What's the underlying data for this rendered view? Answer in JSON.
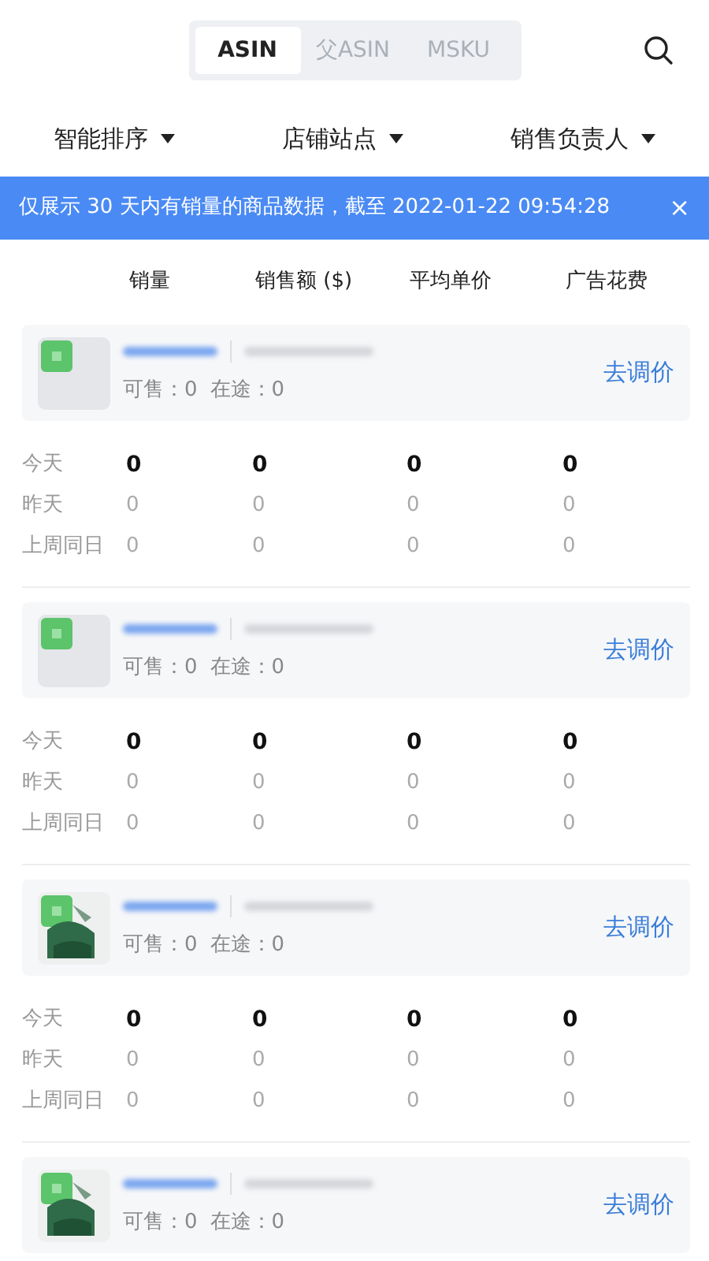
{
  "tabs": [
    {
      "label": "ASIN",
      "selected": true
    },
    {
      "label": "父ASIN",
      "selected": false
    },
    {
      "label": "MSKU",
      "selected": false
    }
  ],
  "filters": [
    "智能排序",
    "店铺站点",
    "销售负责人"
  ],
  "notice": {
    "text": "仅展示 30 天内有销量的商品数据，截至 2022-01-22 09:54:28",
    "close": "×"
  },
  "columns": [
    "销量",
    "销售额 ($)",
    "平均单价",
    "广告花费"
  ],
  "products": [
    {
      "available": "可售：0",
      "in_transit": "在途：0",
      "action": "去调价",
      "rows": [
        {
          "kind": "today",
          "label": "今天",
          "values": [
            "0",
            "0",
            "0",
            "0"
          ]
        },
        {
          "kind": "past",
          "label": "昨天",
          "values": [
            "0",
            "0",
            "0",
            "0"
          ]
        },
        {
          "kind": "past",
          "label": "上周同日",
          "values": [
            "0",
            "0",
            "0",
            "0"
          ]
        }
      ]
    },
    {
      "available": "可售：0",
      "in_transit": "在途：0",
      "action": "去调价",
      "rows": [
        {
          "kind": "today",
          "label": "今天",
          "values": [
            "0",
            "0",
            "0",
            "0"
          ]
        },
        {
          "kind": "past",
          "label": "昨天",
          "values": [
            "0",
            "0",
            "0",
            "0"
          ]
        },
        {
          "kind": "past",
          "label": "上周同日",
          "values": [
            "0",
            "0",
            "0",
            "0"
          ]
        }
      ]
    },
    {
      "available": "可售：0",
      "in_transit": "在途：0",
      "action": "去调价",
      "rows": [
        {
          "kind": "today",
          "label": "今天",
          "values": [
            "0",
            "0",
            "0",
            "0"
          ]
        },
        {
          "kind": "past",
          "label": "昨天",
          "values": [
            "0",
            "0",
            "0",
            "0"
          ]
        },
        {
          "kind": "past",
          "label": "上周同日",
          "values": [
            "0",
            "0",
            "0",
            "0"
          ]
        }
      ]
    },
    {
      "available": "可售：0",
      "in_transit": "在途：0",
      "action": "去调价"
    }
  ]
}
